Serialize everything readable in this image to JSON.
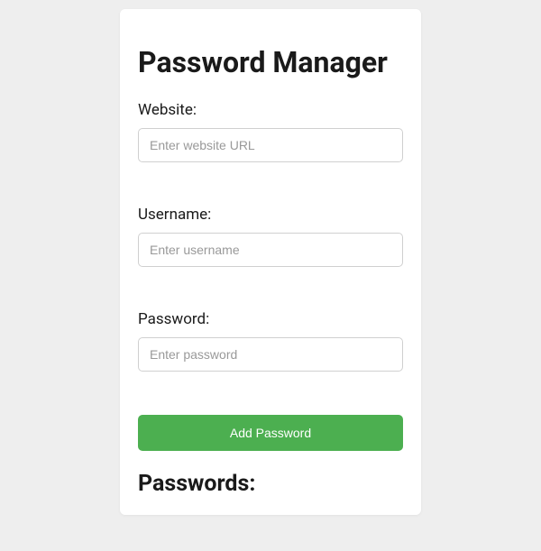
{
  "header": {
    "title": "Password Manager"
  },
  "form": {
    "website": {
      "label": "Website:",
      "placeholder": "Enter website URL",
      "value": ""
    },
    "username": {
      "label": "Username:",
      "placeholder": "Enter username",
      "value": ""
    },
    "password": {
      "label": "Password:",
      "placeholder": "Enter password",
      "value": ""
    },
    "submit_label": "Add Password"
  },
  "list": {
    "heading": "Passwords:"
  }
}
